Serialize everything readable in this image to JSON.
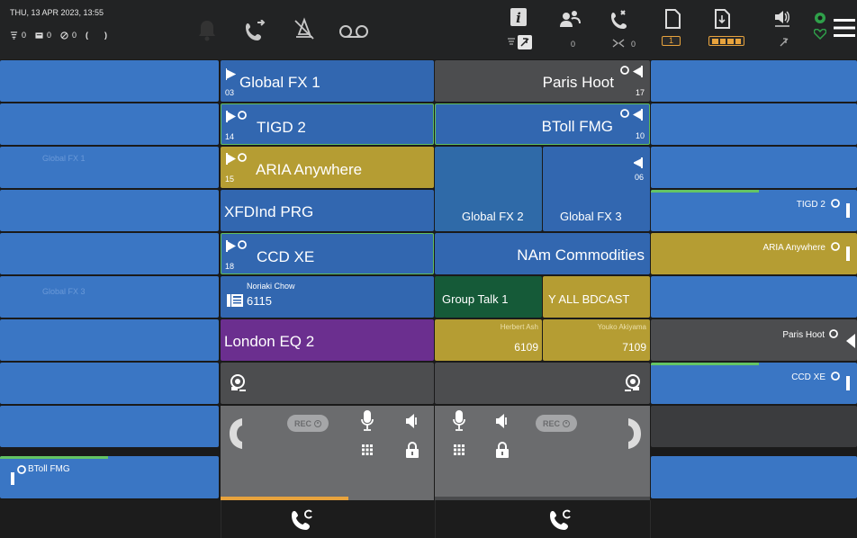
{
  "topbar": {
    "datetime": "THU, 13 APR 2023, 13:55",
    "counters": [
      "0",
      "0",
      "0"
    ],
    "bracket_left": "(",
    "bracket_right": ")",
    "info_badge_count": "",
    "group_count": "0",
    "transfer_count": "0",
    "page_value": "1",
    "accent_color": "#e8a33d"
  },
  "keys_left": [
    {
      "label": ""
    },
    {
      "label": ""
    },
    {
      "label": "Global FX 1"
    },
    {
      "label": ""
    },
    {
      "label": ""
    },
    {
      "label": "Global FX 3"
    },
    {
      "label": ""
    },
    {
      "label": ""
    },
    {
      "label": ""
    },
    {
      "label": "BToll FMG"
    }
  ],
  "keys_center_left": [
    {
      "label": "Global FX 1",
      "num": "03"
    },
    {
      "label": "TIGD 2",
      "num": "14"
    },
    {
      "label": "ARIA Anywhere",
      "num": "15"
    },
    {
      "label": "XFDInd PRG"
    },
    {
      "label": "CCD XE",
      "num": "18"
    },
    {
      "name": "Noriaki Chow",
      "ext": "6115"
    },
    {
      "label": "London EQ 2"
    }
  ],
  "keys_center_right": [
    {
      "label": "Paris Hoot",
      "num": "17"
    },
    {
      "label": "BToll FMG",
      "num": "10"
    },
    {
      "label": "",
      "num": "06"
    },
    {
      "label_a": "Global FX 2",
      "label_b": "Global FX 3"
    },
    {
      "label": "NAm Commodities"
    },
    {
      "label_a": "Group Talk 1",
      "label_b": "Y ALL BDCAST"
    },
    {
      "name_a": "Herbert Ash",
      "ext_a": "6109",
      "name_b": "Youko Akiyama",
      "ext_b": "7109"
    }
  ],
  "keys_right": [
    {
      "label": ""
    },
    {
      "label": ""
    },
    {
      "label": ""
    },
    {
      "label": "TIGD 2"
    },
    {
      "label": "ARIA Anywhere"
    },
    {
      "label": ""
    },
    {
      "label": "Paris Hoot"
    },
    {
      "label": "CCD XE"
    },
    {
      "label": ""
    },
    {
      "label": ""
    }
  ],
  "handset": {
    "rec_label": "REC"
  },
  "colors": {
    "blue": "#3a76c4",
    "mustard": "#b59d33",
    "purple": "#6b2f8f",
    "dark_green": "#155a38",
    "gray": "#4c4d4f",
    "active_green": "#5fbf5f"
  }
}
